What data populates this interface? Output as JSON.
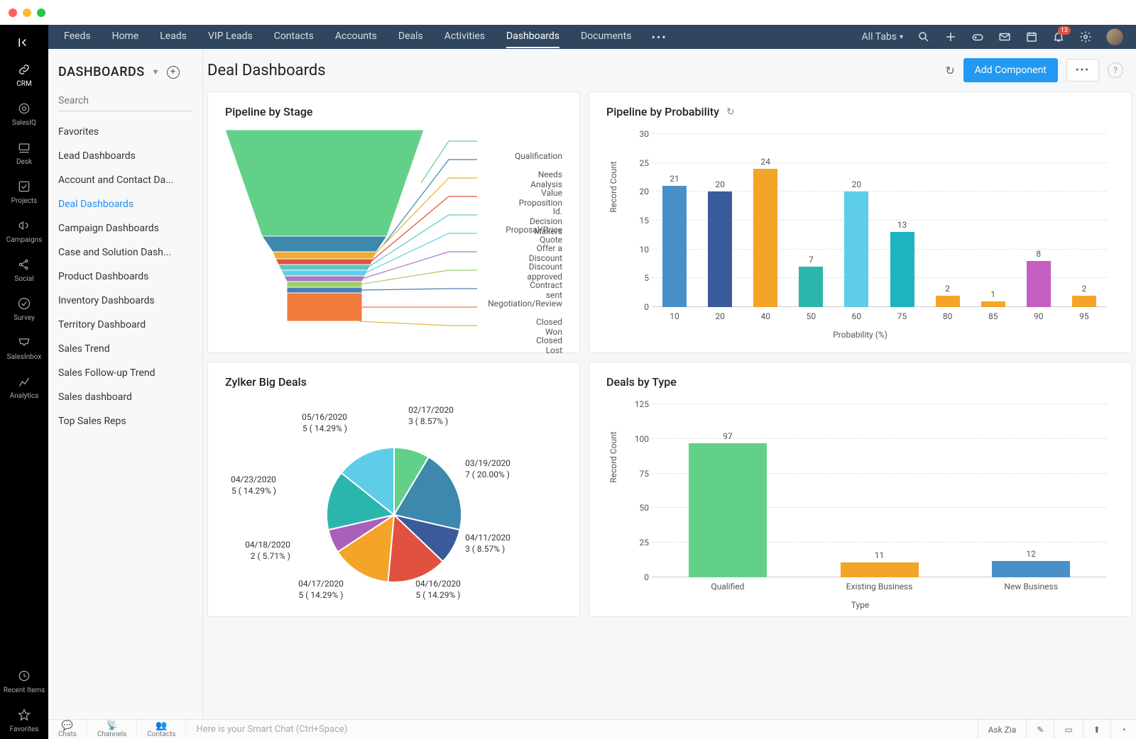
{
  "macDots": [
    "#ff5f57",
    "#febc2e",
    "#28c840"
  ],
  "appRail": {
    "items": [
      {
        "label": "CRM",
        "icon": "link"
      },
      {
        "label": "SalesIQ",
        "icon": "target"
      },
      {
        "label": "Desk",
        "icon": "desk"
      },
      {
        "label": "Projects",
        "icon": "check"
      },
      {
        "label": "Campaigns",
        "icon": "horn"
      },
      {
        "label": "Social",
        "icon": "share"
      },
      {
        "label": "Survey",
        "icon": "tick"
      },
      {
        "label": "SalesInbox",
        "icon": "inbox"
      },
      {
        "label": "Analytics",
        "icon": "chart"
      }
    ],
    "bottom": [
      {
        "label": "Recent Items",
        "icon": "clock"
      },
      {
        "label": "Favorites",
        "icon": "star"
      }
    ],
    "activeIndex": 0
  },
  "topNav": {
    "tabs": [
      "Feeds",
      "Home",
      "Leads",
      "VIP Leads",
      "Contacts",
      "Accounts",
      "Deals",
      "Activities",
      "Dashboards",
      "Documents"
    ],
    "activeTab": "Dashboards",
    "allTabsLabel": "All Tabs",
    "notificationCount": "13"
  },
  "sidePanel": {
    "title": "DASHBOARDS",
    "searchPlaceholder": "Search",
    "items": [
      "Favorites",
      "Lead Dashboards",
      "Account and Contact Da...",
      "Deal Dashboards",
      "Campaign Dashboards",
      "Case and Solution Dash...",
      "Product Dashboards",
      "Inventory Dashboards",
      "Territory Dashboard",
      "Sales Trend",
      "Sales Follow-up Trend",
      "Sales dashboard",
      "Top Sales Reps"
    ],
    "activeIndex": 3
  },
  "main": {
    "title": "Deal Dashboards",
    "addComponentLabel": "Add Component"
  },
  "cards": {
    "funnel": {
      "title": "Pipeline by Stage"
    },
    "barProb": {
      "title": "Pipeline by Probability"
    },
    "pie": {
      "title": "Zylker Big Deals"
    },
    "barType": {
      "title": "Deals by Type"
    }
  },
  "bottomBar": {
    "segments": [
      "Chats",
      "Channels",
      "Contacts"
    ],
    "smartPlaceholder": "Here is your Smart Chat (Ctrl+Space)",
    "askZia": "Ask Zia"
  },
  "chart_data": [
    {
      "id": "pipeline_by_stage",
      "type": "funnel",
      "title": "Pipeline by Stage",
      "stages": [
        {
          "label": "Qualification",
          "color": "#63d08a"
        },
        {
          "label": "Needs Analysis",
          "color": "#3d88ac"
        },
        {
          "label": "Value Proposition",
          "color": "#f0ab33"
        },
        {
          "label": "Id. Decision Makers",
          "color": "#e2503f"
        },
        {
          "label": "Proposal/Price Quote",
          "color": "#56c9c1"
        },
        {
          "label": "Offer a Discount",
          "color": "#61cde6"
        },
        {
          "label": "Discount approved",
          "color": "#aa78c1"
        },
        {
          "label": "Contract sent",
          "color": "#9bcf6a"
        },
        {
          "label": "Negotiation/Review",
          "color": "#4a7fb3"
        },
        {
          "label": "Closed Won",
          "color": "#f07a3c"
        },
        {
          "label": "Closed Lost",
          "color": "#e2b93a"
        }
      ]
    },
    {
      "id": "pipeline_by_probability",
      "type": "bar",
      "title": "Pipeline by Probability",
      "xlabel": "Probability (%)",
      "ylabel": "Record Count",
      "ylim": [
        0,
        30
      ],
      "yticks": [
        0,
        5,
        10,
        15,
        20,
        25,
        30
      ],
      "categories": [
        "10",
        "20",
        "40",
        "50",
        "60",
        "75",
        "80",
        "85",
        "90",
        "95"
      ],
      "values": [
        21,
        20,
        24,
        7,
        20,
        13,
        2,
        1,
        8,
        2
      ],
      "colors": [
        "#4a90c8",
        "#3a5a99",
        "#f4a428",
        "#2bb6ad",
        "#5ecde8",
        "#1fb2bf",
        "#f4a428",
        "#f4a428",
        "#c35fc0",
        "#f4a428"
      ]
    },
    {
      "id": "zylker_big_deals",
      "type": "pie",
      "title": "Zylker Big Deals",
      "slices": [
        {
          "label": "02/17/2020",
          "count": 3,
          "pct": 8.57,
          "color": "#63d08a"
        },
        {
          "label": "03/19/2020",
          "count": 7,
          "pct": 20.0,
          "color": "#3d88ac"
        },
        {
          "label": "04/11/2020",
          "count": 3,
          "pct": 8.57,
          "color": "#3a5a99"
        },
        {
          "label": "04/16/2020",
          "count": 5,
          "pct": 14.29,
          "color": "#e2503f"
        },
        {
          "label": "04/17/2020",
          "count": 5,
          "pct": 14.29,
          "color": "#f4a428"
        },
        {
          "label": "04/18/2020",
          "count": 2,
          "pct": 5.71,
          "color": "#aa5fbb"
        },
        {
          "label": "04/23/2020",
          "count": 5,
          "pct": 14.29,
          "color": "#2bb6ad"
        },
        {
          "label": "05/16/2020",
          "count": 5,
          "pct": 14.29,
          "color": "#5ecde8"
        }
      ]
    },
    {
      "id": "deals_by_type",
      "type": "bar",
      "title": "Deals by Type",
      "xlabel": "Type",
      "ylabel": "Record Count",
      "ylim": [
        0,
        125
      ],
      "yticks": [
        0,
        25,
        50,
        75,
        100,
        125
      ],
      "categories": [
        "Qualified",
        "Existing Business",
        "New Business"
      ],
      "values": [
        97,
        11,
        12
      ],
      "colors": [
        "#63d08a",
        "#f4a428",
        "#4a90c8"
      ]
    }
  ]
}
